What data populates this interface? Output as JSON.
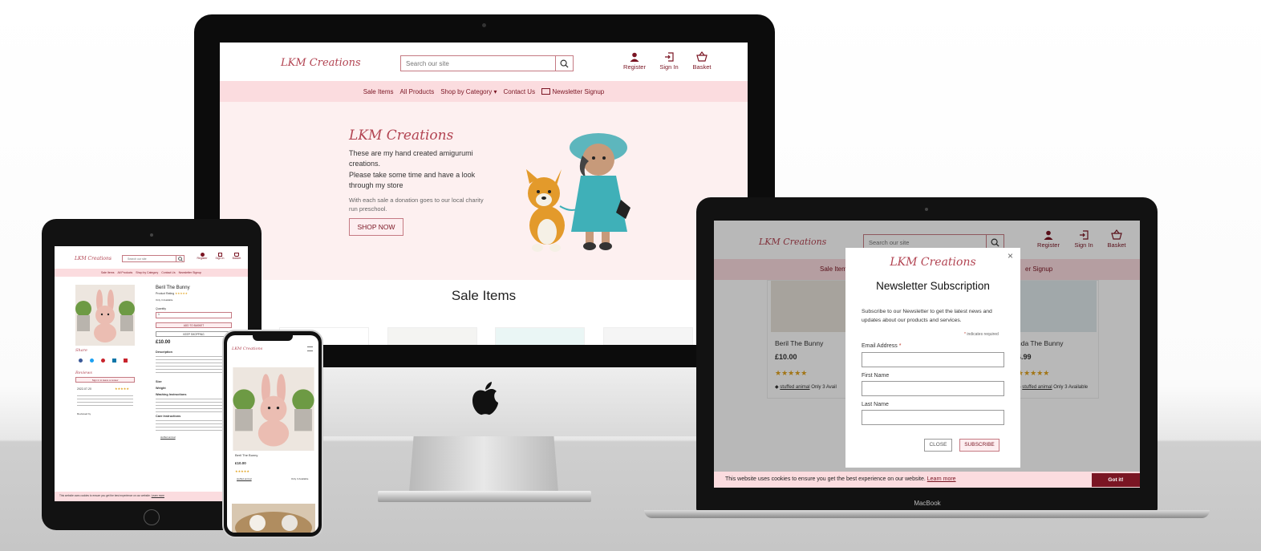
{
  "site": {
    "brand": "LKM Creations",
    "search_placeholder": "Search our site",
    "account": {
      "register": "Register",
      "sign_in": "Sign In",
      "basket": "Basket"
    },
    "nav": [
      "Sale Items",
      "All Products",
      "Shop by Category",
      "Contact Us",
      "Newsletter Signup"
    ]
  },
  "imac": {
    "hero": {
      "title": "LKM Creations",
      "line1": "These are my hand created amigurumi creations.",
      "line2": "Please take some time and have a look through my store",
      "charity": "With each sale a donation goes to our local charity run preschool.",
      "cta": "SHOP NOW"
    },
    "section_title": "Sale Items"
  },
  "tablet": {
    "product_name": "Beril The Bunny",
    "rating_label": "Product Rating",
    "availability": "Only 3 Available",
    "quantity_label": "Quantity",
    "quantity_value": "1",
    "add_button": "ADD TO BASKET",
    "keep_shopping": "KEEP SHOPPING",
    "price": "£10.00",
    "description_label": "Description",
    "size_label": "Size",
    "weight_label": "Weight",
    "washing_label": "Washing Instructions",
    "care_label": "Care Instructions",
    "share_label": "Share",
    "reviews_label": "Reviews",
    "review_date": "2022-07-20",
    "review_cta": "Sign in to leave a review",
    "reviewed_by": "Reviewed by",
    "cookie_text": "This website uses cookies to ensure you get the best experience on our website.",
    "cookie_learn": "Learn more",
    "tag": "stuffed animal"
  },
  "phone": {
    "product_name": "Beril The Bunny",
    "price": "£10.00",
    "tag": "stuffed animal",
    "availability": "Only 3 Available"
  },
  "laptop": {
    "cards": [
      {
        "name": "Beril The Bunny",
        "price": "£10.00",
        "tag": "stuffed animal",
        "availability": "Only 3 Avail"
      },
      {
        "name": "nda The Bunny",
        "price": "4.99",
        "tag": "stuffed animal",
        "availability": "Only 3 Available"
      }
    ],
    "modal": {
      "title": "Newsletter Subscription",
      "intro": "Subscribe to our Newsletter to get the latest news and updates about our products and services.",
      "required_note": "indicates required",
      "email_label": "Email Address",
      "first_label": "First Name",
      "last_label": "Last Name",
      "close": "CLOSE",
      "subscribe": "SUBSCRIBE",
      "close_x": "×"
    },
    "nav_left": "Sale Items",
    "nav_right": "er Signup",
    "cookie_text": "This website uses cookies to ensure you get the best experience on our website.",
    "cookie_learn": "Learn more",
    "cookie_button": "Got it!",
    "brand_label": "MacBook"
  },
  "colors": {
    "accent": "#7a1523",
    "pink": "#fbdcdf",
    "hero_bg": "#fdf0f0"
  }
}
